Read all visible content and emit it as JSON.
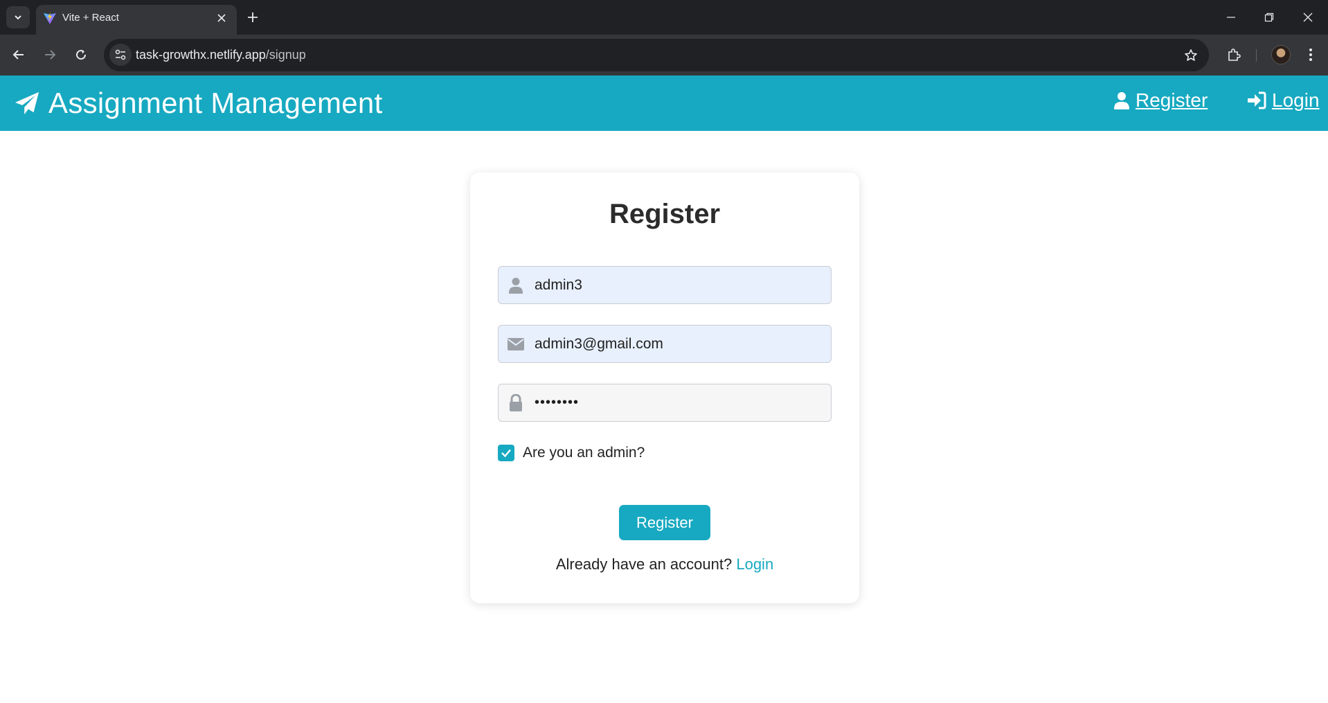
{
  "browser": {
    "tab_title": "Vite + React",
    "url_host": "task-growthx.netlify.app",
    "url_path": "/signup"
  },
  "header": {
    "brand": "Assignment Management",
    "nav": {
      "register": "Register",
      "login": "Login"
    }
  },
  "form": {
    "title": "Register",
    "username_value": "admin3",
    "email_value": "admin3@gmail.com",
    "password_masked": "••••••••",
    "admin_checkbox_label": "Are you an admin?",
    "admin_checked": true,
    "submit_label": "Register",
    "footer_prompt": "Already have an account?",
    "footer_link": "Login"
  },
  "colors": {
    "accent": "#17a9c1",
    "autofill_bg": "#e8f0fe",
    "chrome_dark": "#202124"
  }
}
